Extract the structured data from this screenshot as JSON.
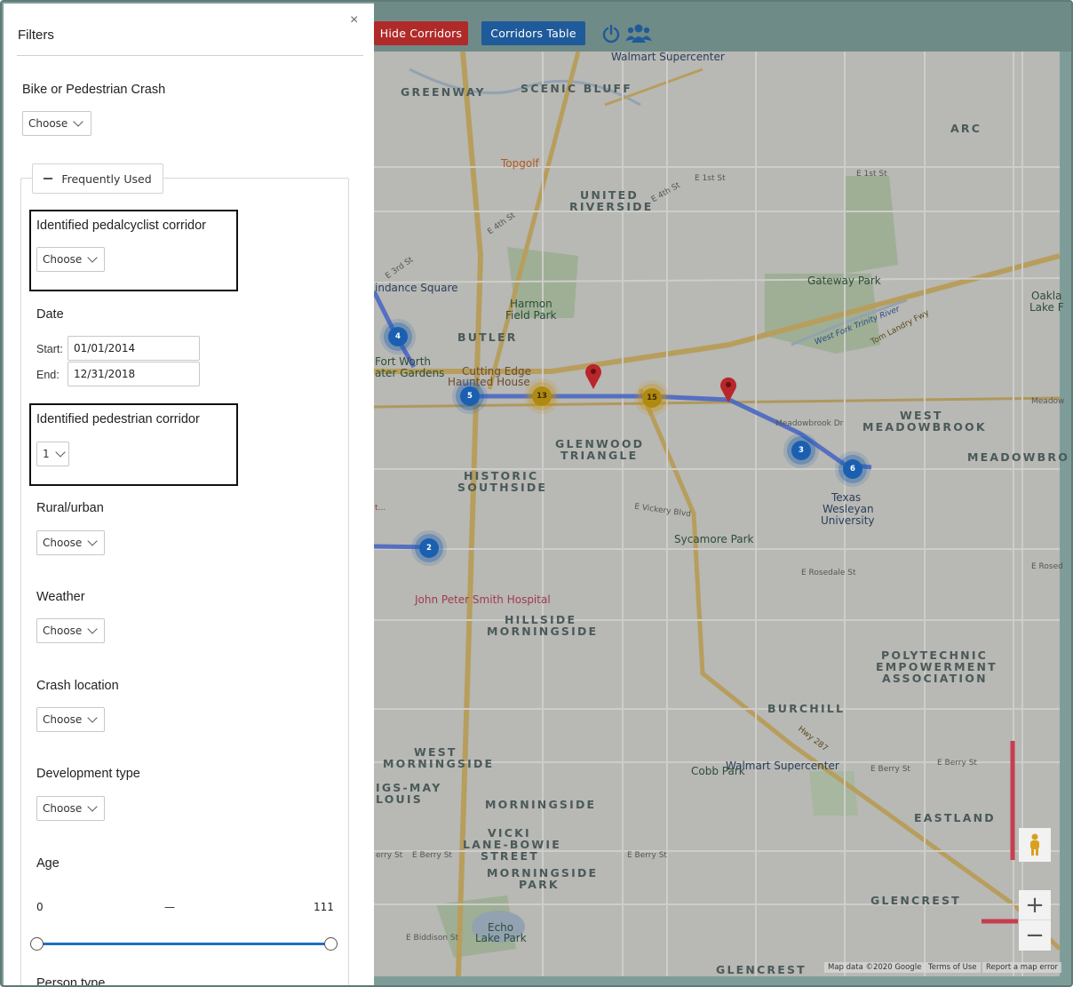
{
  "toolbar": {
    "hide_corridors": "Hide Corridors",
    "corridors_table": "Corridors Table",
    "power_icon": "power-icon",
    "users_icon": "users-icon",
    "hide_color": "#b02a2a",
    "table_color": "#1f5a9a"
  },
  "panel": {
    "title": "Filters",
    "close_glyph": "×",
    "bike_ped_crash": {
      "label": "Bike or Pedestrian Crash",
      "value": "Choose"
    },
    "frequently_used_label": "Frequently Used",
    "pedalcyclist_corridor": {
      "label": "Identified pedalcyclist corridor",
      "value": "Choose"
    },
    "date": {
      "label": "Date",
      "start_label": "Start:",
      "start_value": "01/01/2014",
      "end_label": "End:",
      "end_value": "12/31/2018"
    },
    "pedestrian_corridor": {
      "label": "Identified pedestrian corridor",
      "value": "1"
    },
    "rural_urban": {
      "label": "Rural/urban",
      "value": "Choose"
    },
    "weather": {
      "label": "Weather",
      "value": "Choose"
    },
    "crash_location": {
      "label": "Crash location",
      "value": "Choose"
    },
    "development_type": {
      "label": "Development type",
      "value": "Choose"
    },
    "age": {
      "label": "Age",
      "min": "0",
      "separator": "—",
      "max": "111"
    },
    "person_type_label": "Person type"
  },
  "map": {
    "labels": {
      "greenway": "GREENWAY",
      "scenic_bluff": "SCENIC BLUFF",
      "arc": "ARC",
      "united_riverside_1": "UNITED",
      "united_riverside_2": "RIVERSIDE",
      "butler": "BUTLER",
      "glenwood_1": "GLENWOOD",
      "glenwood_2": "TRIANGLE",
      "historic_1": "HISTORIC",
      "historic_2": "SOUTHSIDE",
      "west_meadowbrook_1": "WEST",
      "west_meadowbrook_2": "MEADOWBROOK",
      "meadowbrook": "MEADOWBRO",
      "hillside_1": "HILLSIDE",
      "hillside_2": "MORNINGSIDE",
      "polytechnic_1": "POLYTECHNIC",
      "polytechnic_2": "EMPOWERMENT",
      "polytechnic_3": "ASSOCIATION",
      "burchill": "BURCHILL",
      "west_morningside_1": "WEST",
      "west_morningside_2": "MORNINGSIDE",
      "gs_may_1": "IGS-MAY",
      "gs_may_2": "LOUIS",
      "morningside": "MORNINGSIDE",
      "vicki_1": "VICKI",
      "vicki_2": "LANE-BOWIE",
      "vicki_3": "STREET",
      "morningside_park_1": "MORNINGSIDE",
      "morningside_park_2": "PARK",
      "eastland": "EASTLAND",
      "glencrest": "GLENCREST",
      "glencrest_bottom": "GLENCREST",
      "gateway_park": "Gateway Park",
      "harmon_1": "Harmon",
      "harmon_2": "Field Park",
      "topgolf": "Topgolf",
      "walmart_top": "Walmart Supercenter",
      "walmart_bottom": "Walmart Supercenter",
      "fort_worth_1": "Fort Worth",
      "fort_worth_2": "ater Gardens",
      "indance": "indance Square",
      "cutting_edge_1": "Cutting Edge",
      "cutting_edge_2": "Haunted House",
      "sycamore": "Sycamore Park",
      "texas_wesleyan_1": "Texas",
      "texas_wesleyan_2": "Wesleyan",
      "texas_wesleyan_3": "University",
      "john_peter_smith": "John Peter Smith Hospital",
      "cobb_park": "Cobb Park",
      "echo_lake_1": "Echo",
      "echo_lake_2": "Lake Park",
      "oakland_1": "Oakla",
      "oakland_2": "Lake F",
      "e_vickery": "E Vickery Blvd",
      "e_rosedale": "E Rosedale St",
      "e_rosed": "E Rosed",
      "e_berry_1": "E Berry St",
      "e_berry_2": "E Berry St",
      "e_berry_3": "E Berry St",
      "e_berry_4": "E Berry St",
      "erry_st": "erry St",
      "e_1st": "E 1st St",
      "e_1st_2": "E 1st St",
      "e_4th": "E 4th St",
      "e_4th_2": "E 4th St",
      "e_3rd": "E 3rd St",
      "e_biddison": "E Biddison St",
      "meadowbrook_dr": "Meadowbrook Dr",
      "tom_landry": "Tom Landry Fwy",
      "west_fork": "West Fork Trinity River",
      "hwy_287": "Hwy 287",
      "meadow": "Meadow",
      "t_ellipsis": "t..."
    },
    "clusters": [
      "4",
      "5",
      "13",
      "15",
      "3",
      "6",
      "2"
    ],
    "attribution": {
      "map_data": "Map data ©2020 Google",
      "terms": "Terms of Use",
      "report": "Report a map error"
    },
    "zoom_in": "+",
    "zoom_out": "−",
    "pegman_icon": "pegman-icon",
    "corridor_color": "#3b5fd6",
    "red_corridor_color": "#d9344a"
  }
}
